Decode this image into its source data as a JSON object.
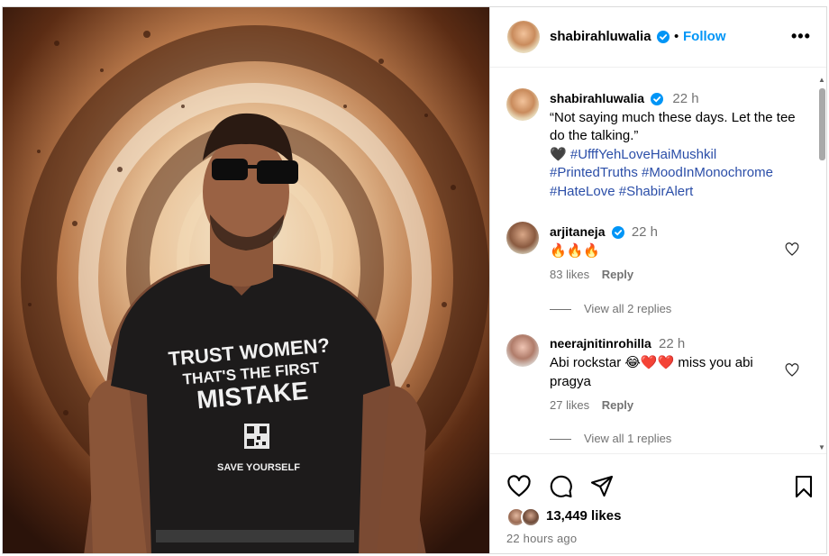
{
  "post": {
    "author": "shabirahluwalia",
    "follow_label": "Follow",
    "separator": "•",
    "more_label": "•••",
    "shirt_text": {
      "line1": "TRUST WOMEN?",
      "line2": "THAT'S THE FIRST",
      "line3": "MISTAKE",
      "line4": "SAVE YOURSELF"
    }
  },
  "caption": {
    "username": "shabirahluwalia",
    "time": "22 h",
    "text": "“Not saying much these days. Let the tee do the talking.”",
    "heart": "🖤",
    "hashtags": [
      "#UfffYehLoveHaiMushkil",
      "#PrintedTruths",
      "#MoodInMonochrome",
      "#HateLove",
      "#ShabirAlert"
    ]
  },
  "comments": [
    {
      "username": "arjitaneja",
      "time": "22 h",
      "text": "🔥🔥🔥",
      "likes": "83 likes",
      "reply_label": "Reply",
      "view_replies": "View all 2 replies"
    },
    {
      "username": "neerajnitinrohilla",
      "time": "22 h",
      "text": "Abi rockstar 😂❤️❤️ miss you abi pragya",
      "likes": "27 likes",
      "reply_label": "Reply",
      "view_replies": "View all 1 replies"
    }
  ],
  "footer": {
    "likes": "13,449 likes",
    "time_ago": "22 hours ago"
  },
  "colors": {
    "link": "#0095f6",
    "hashtag": "#2b4ea8",
    "muted": "#737373"
  }
}
